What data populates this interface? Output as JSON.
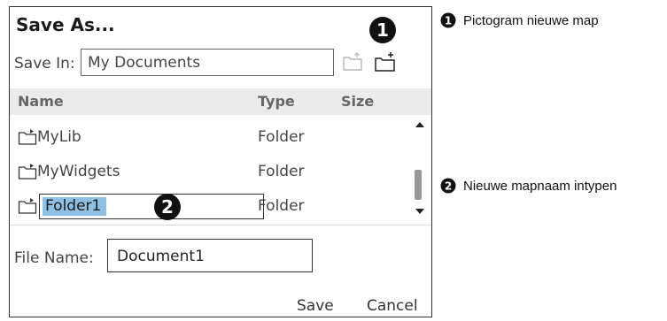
{
  "dialog": {
    "title": "Save As...",
    "save_in_label": "Save In:",
    "save_in_value": "My Documents",
    "icons": {
      "up_folder": "folder-up-icon",
      "new_folder": "new-folder-icon"
    },
    "columns": {
      "name": "Name",
      "type": "Type",
      "size": "Size"
    },
    "rows": [
      {
        "name": "MyLib",
        "type": "Folder",
        "icon": "folder-icon"
      },
      {
        "name": "MyWidgets",
        "type": "Folder",
        "icon": "folder-icon"
      },
      {
        "name": "Folder1",
        "type": "Folder",
        "icon": "folder-icon",
        "editing": true
      }
    ],
    "file_name_label": "File Name:",
    "file_name_value": "Document1",
    "buttons": {
      "save": "Save",
      "cancel": "Cancel"
    },
    "selection_color": "#8fbfe3"
  },
  "callouts": [
    {
      "number": "1",
      "text": "Pictogram nieuwe map"
    },
    {
      "number": "2",
      "text": "Nieuwe mapnaam intypen"
    }
  ]
}
